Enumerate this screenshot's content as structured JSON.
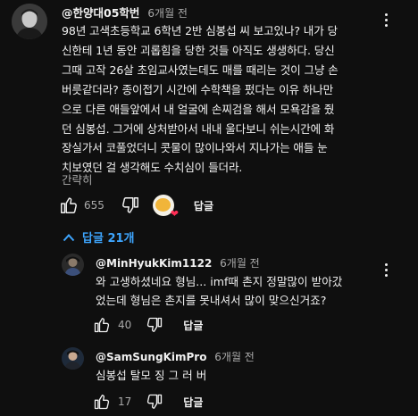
{
  "comment": {
    "author": "@한양대05학번",
    "time": "6개월 전",
    "lines": [
      "98년 고색초등학교 6학년 2반 심봉섭 씨 보고있나? 내가 당",
      "신한테 1년 동안 괴롭힘을 당한 것들 아직도 생생하다. 당신",
      "그때 고작 26살 초임교사였는데도 매를 때리는 것이 그냥 손",
      "버릇같더라? 종이접기 시간에 수학책을 펐다는 이유 하나만",
      "으로 다른 애들앞에서 내 얼굴에 손찌검을 해서 모욕감을 줬",
      "던 심봉섭. 그거에 상처받아서 내내 울다보니 쉬는시간에 화",
      "장실가서 코풀었더니 콧물이 많이나와서 지나가는 애들 눈",
      "치보였던 걸 생각해도 수치심이 들더라."
    ],
    "read_more": "간략히",
    "likes": "655",
    "reply_label": "답글"
  },
  "replies_toggle": {
    "label": "답글 21개"
  },
  "replies": [
    {
      "author": "@MinHyukKim1122",
      "time": "6개월 전",
      "lines": [
        "와 고생하셨네요 형님... imf때 촌지 정말많이 받아갔",
        "었는데 형님은 촌지를 못내셔서 많이 맞으신거죠?"
      ],
      "likes": "40",
      "reply_label": "답글"
    },
    {
      "author": "@SamSungKimPro",
      "time": "6개월 전",
      "lines": [
        "심봉섭 탈모 징 그 러 버"
      ],
      "likes": "17",
      "reply_label": "답글"
    }
  ],
  "colors": {
    "background": "#0f0f0f",
    "text": "#f1f1f1",
    "muted": "#aaaaaa",
    "link": "#3ea6ff",
    "heart": "#ff2d55"
  },
  "icons": [
    "more-vert-icon",
    "thumb-up-icon",
    "thumb-down-icon",
    "chevron-up-icon",
    "heart-icon"
  ]
}
